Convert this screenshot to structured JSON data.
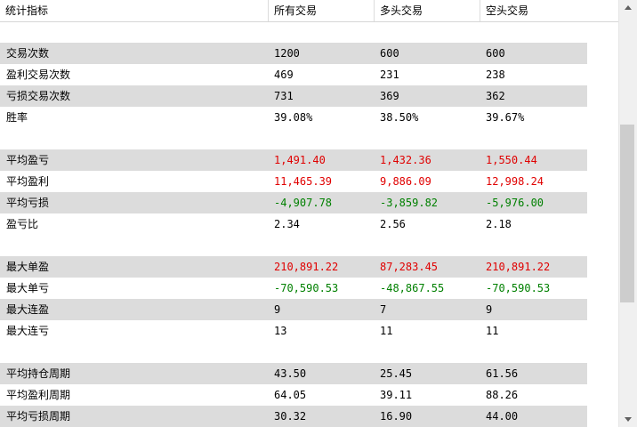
{
  "header": {
    "col0": "统计指标",
    "col1": "所有交易",
    "col2": "多头交易",
    "col3": "空头交易"
  },
  "rows": [
    {
      "label": "交易次数",
      "all": "1200",
      "long": "600",
      "short": "600"
    },
    {
      "label": "盈利交易次数",
      "all": "469",
      "long": "231",
      "short": "238"
    },
    {
      "label": "亏损交易次数",
      "all": "731",
      "long": "369",
      "short": "362"
    },
    {
      "label": "胜率",
      "all": "39.08%",
      "long": "38.50%",
      "short": "39.67%"
    },
    {
      "label": "平均盈亏",
      "all": "1,491.40",
      "long": "1,432.36",
      "short": "1,550.44"
    },
    {
      "label": "平均盈利",
      "all": "11,465.39",
      "long": "9,886.09",
      "short": "12,998.24"
    },
    {
      "label": "平均亏损",
      "all": "-4,907.78",
      "long": "-3,859.82",
      "short": "-5,976.00"
    },
    {
      "label": "盈亏比",
      "all": "2.34",
      "long": "2.56",
      "short": "2.18"
    },
    {
      "label": "最大单盈",
      "all": "210,891.22",
      "long": "87,283.45",
      "short": "210,891.22"
    },
    {
      "label": "最大单亏",
      "all": "-70,590.53",
      "long": "-48,867.55",
      "short": "-70,590.53"
    },
    {
      "label": "最大连盈",
      "all": "9",
      "long": "7",
      "short": "9"
    },
    {
      "label": "最大连亏",
      "all": "13",
      "long": "11",
      "short": "11"
    },
    {
      "label": "平均持仓周期",
      "all": "43.50",
      "long": "25.45",
      "short": "61.56"
    },
    {
      "label": "平均盈利周期",
      "all": "64.05",
      "long": "39.11",
      "short": "88.26"
    },
    {
      "label": "平均亏损周期",
      "all": "30.32",
      "long": "16.90",
      "short": "44.00"
    }
  ],
  "colors": {
    "positive": "#e00000",
    "negative": "#008000",
    "row_shade": "#dcdcdc"
  }
}
